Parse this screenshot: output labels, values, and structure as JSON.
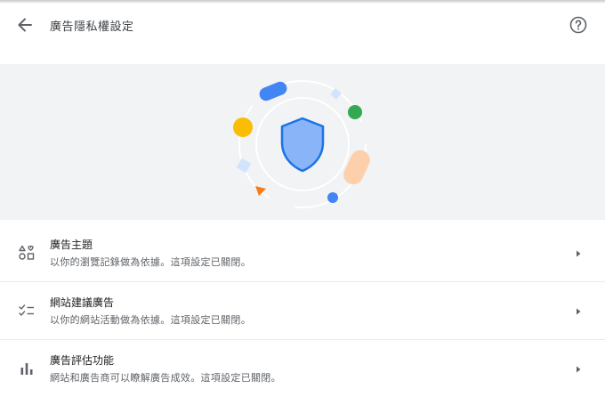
{
  "header": {
    "title": "廣告隱私權設定",
    "back_icon": "arrow-back-icon",
    "help_icon": "help-circle-icon"
  },
  "colors": {
    "banner_bg": "#f1f3f4",
    "shield": "#8ab4f8",
    "shield_stroke": "#1a73e8",
    "blue": "#4285f4",
    "green": "#34a853",
    "yellow": "#fbbc04",
    "orange": "#fa7b17",
    "peach": "#fdcfab"
  },
  "settings": [
    {
      "title": "廣告主題",
      "subtitle": "以你的瀏覽記錄做為依據。這項設定已關閉。",
      "icon": "topics-icon"
    },
    {
      "title": "網站建議廣告",
      "subtitle": "以你的網站活動做為依據。這項設定已關閉。",
      "icon": "checklist-icon"
    },
    {
      "title": "廣告評估功能",
      "subtitle": "網站和廣告商可以瞭解廣告成效。這項設定已關閉。",
      "icon": "bar-chart-icon"
    }
  ]
}
